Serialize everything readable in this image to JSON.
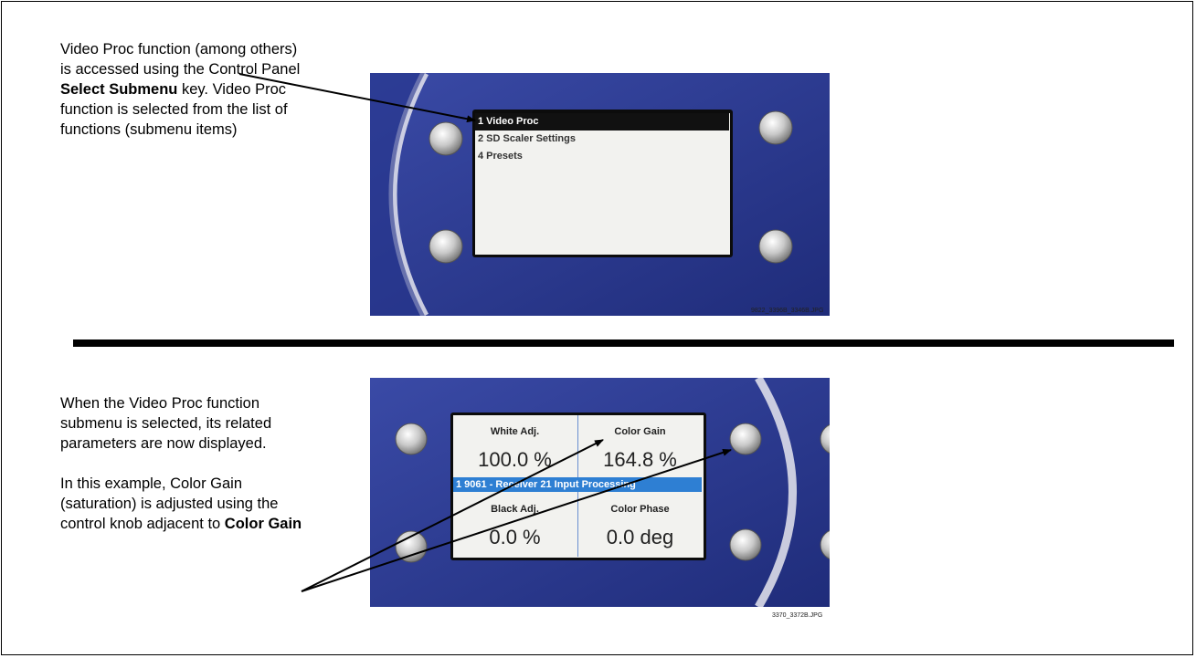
{
  "section1": {
    "caption_part1": "Video Proc function (among others) is accessed using the Control Panel ",
    "caption_bold": "Select Submenu",
    "caption_part2": " key. Video Proc function is selected from the list of functions (submenu items)",
    "menu_items": [
      "1 Video Proc",
      "2 SD Scaler Settings",
      "4 Presets"
    ],
    "image_id": "9822_3396B_3346B.JPG"
  },
  "section2": {
    "caption_para1": "When the Video Proc function submenu is selected, its related parameters are now displayed.",
    "caption_para2": "In this example, Color Gain (saturation) is adjusted using the control knob adjacent to ",
    "caption_bold": "Color Gain",
    "params": [
      {
        "label": "White Adj.",
        "value": "100.0 %"
      },
      {
        "label": "Color Gain",
        "value": "164.8 %"
      },
      {
        "label": "Black Adj.",
        "value": "0.0 %"
      },
      {
        "label": "Color Phase",
        "value": "0.0 deg"
      }
    ],
    "status_text": "1 9061 - Receiver 21 Input Processing",
    "image_id": "3370_3372B.JPG"
  },
  "colors": {
    "panel_blue": "#2b3a8f",
    "highlight_blue": "#2e7fd3",
    "lcd_bg": "#f2f2ef"
  }
}
